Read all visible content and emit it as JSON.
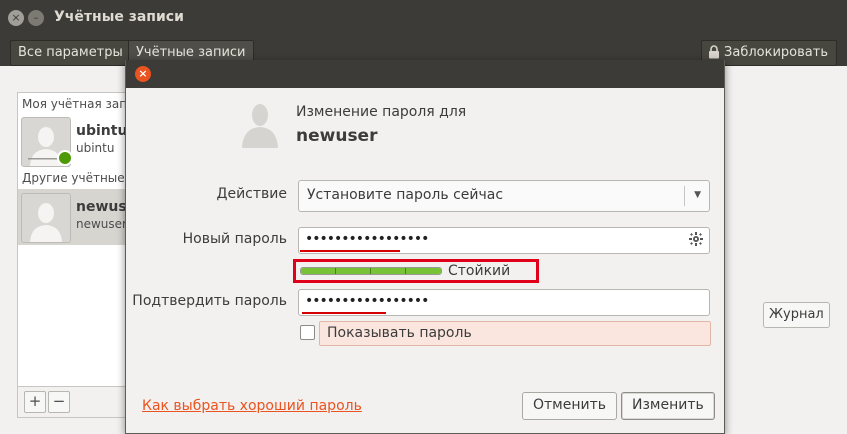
{
  "window": {
    "title": "Учётные записи",
    "close_glyph": "×",
    "minimize_glyph": "–"
  },
  "toolbar": {
    "all_settings": "Все параметры",
    "current_page": "Учётные записи",
    "lock_label": "Заблокировать",
    "lock_icon": "lock-icon"
  },
  "user_list": {
    "my_account_label": "Моя учётная запись",
    "other_accounts_label": "Другие учётные записи",
    "users": [
      {
        "display_name": "ubintu",
        "login": "ubintu",
        "online": true
      },
      {
        "display_name": "newuser",
        "login": "newuser",
        "selected": true
      }
    ],
    "add_glyph": "+",
    "remove_glyph": "−"
  },
  "journal_button": "Журнал",
  "dialog": {
    "close_glyph": "×",
    "heading": "Изменение пароля для",
    "username": "newuser",
    "action_label": "Действие",
    "action_value": "Установите пароль сейчас",
    "new_password_label": "Новый пароль",
    "new_password_value": "•••••••••••••••••",
    "confirm_password_label": "Подтвердить пароль",
    "confirm_password_value": "•••••••••••••••••",
    "strength_fraction": 1.0,
    "strength_text": "Стойкий",
    "show_password_label": "Показывать пароль",
    "help_link": "Как выбрать хороший пароль",
    "cancel_button": "Отменить",
    "ok_button": "Изменить"
  },
  "colors": {
    "accent": "#e95420",
    "titlebar": "#3c3b37",
    "highlight_red": "#e0001a",
    "strength_green": "#78c238",
    "online_green": "#4e9a06"
  }
}
